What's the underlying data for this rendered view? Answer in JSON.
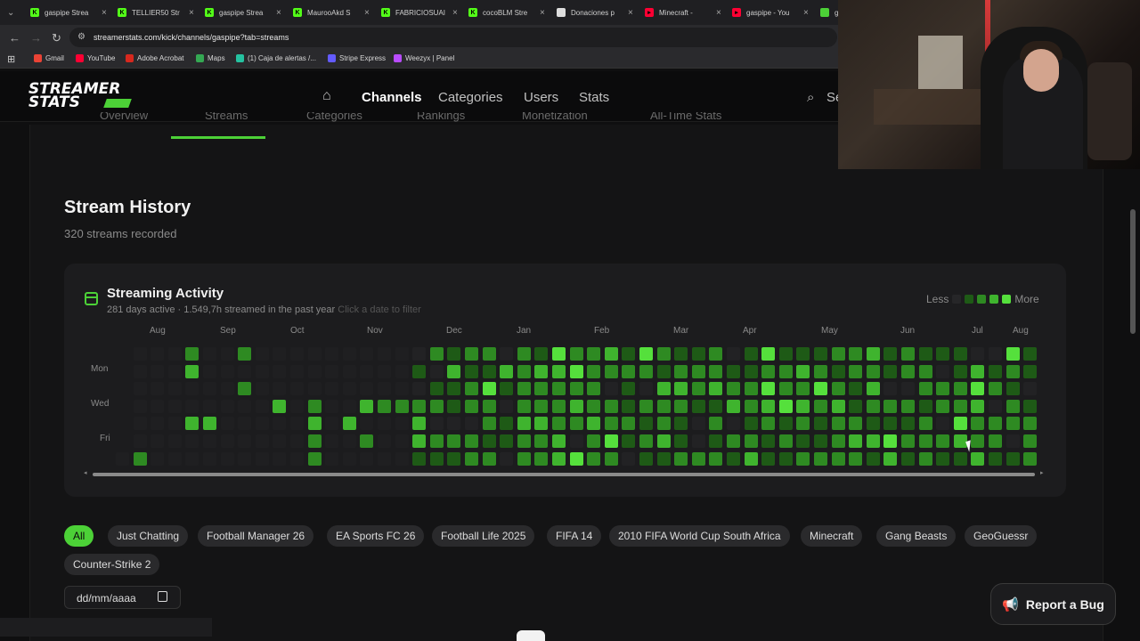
{
  "browser": {
    "tabs": [
      {
        "title": "gaspipe Strea",
        "icon": "kick-icon",
        "color": "#53fc18"
      },
      {
        "title": "TELLIER50 Str",
        "icon": "kick-icon",
        "color": "#53fc18"
      },
      {
        "title": "gaspipe Strea",
        "icon": "kick-icon",
        "color": "#53fc18"
      },
      {
        "title": "MaurooAkd S",
        "icon": "kick-icon",
        "color": "#53fc18"
      },
      {
        "title": "FABRICIOSUAI",
        "icon": "kick-icon",
        "color": "#53fc18"
      },
      {
        "title": "cocoBLM Stre",
        "icon": "kick-icon",
        "color": "#53fc18"
      },
      {
        "title": "Donaciones p",
        "icon": "globe-icon",
        "color": "#dddddd"
      },
      {
        "title": "Minecraft - ",
        "icon": "youtube-icon",
        "color": "#ff0033"
      },
      {
        "title": "gaspipe - You",
        "icon": "youtube-icon",
        "color": "#ff0033"
      },
      {
        "title": "ga",
        "icon": "streamerstats-icon",
        "color": "#4cd137"
      }
    ],
    "url": "streamerstats.com/kick/channels/gaspipe?tab=streams",
    "bookmarks": [
      {
        "label": "Gmail",
        "color": "#ea4335"
      },
      {
        "label": "YouTube",
        "color": "#ff0033"
      },
      {
        "label": "Adobe Acrobat",
        "color": "#d7281e"
      },
      {
        "label": "Maps",
        "color": "#34a853"
      },
      {
        "label": "(1) Caja de alertas /...",
        "color": "#25c2a0"
      },
      {
        "label": "Stripe Express",
        "color": "#635bff"
      },
      {
        "label": "Weezyx | Panel",
        "color": "#b94cff"
      }
    ]
  },
  "site": {
    "logo_line1": "STREAMER",
    "logo_line2": "STATS",
    "nav": {
      "channels": "Channels",
      "categories": "Categories",
      "users": "Users",
      "stats": "Stats",
      "search": "Se"
    },
    "subtabs": [
      "Overview",
      "Streams",
      "Categories",
      "Rankings",
      "Monetization",
      "All-Time Stats"
    ],
    "accent": "#4cd137"
  },
  "page": {
    "title": "Stream History",
    "subtitle": "320 streams recorded"
  },
  "activity": {
    "title": "Streaming Activity",
    "summary": "281 days active · 1.549,7h streamed in the past year",
    "hint": "Click a date to filter",
    "legend_less": "Less",
    "legend_more": "More",
    "legend_colors": [
      "#262628",
      "#1e5a16",
      "#2e8a22",
      "#3fb42e",
      "#55e03c"
    ],
    "months": [
      "Aug",
      "Sep",
      "Oct",
      "Nov",
      "Dec",
      "Jan",
      "Feb",
      "Mar",
      "Apr",
      "May",
      "Jun",
      "Jul",
      "Aug"
    ],
    "day_labels": [
      "Mon",
      "Wed",
      "Fri"
    ]
  },
  "filters": {
    "chips": [
      "All",
      "Just Chatting",
      "Football Manager 26",
      "EA Sports FC 26",
      "Football Life 2025",
      "FIFA 14",
      "2010 FIFA World Cup South Africa",
      "Minecraft",
      "Gang Beasts",
      "GeoGuessr",
      "Counter-Strike 2"
    ],
    "date_placeholder": "dd/mm/aaaa"
  },
  "report_bug": "Report a Bug"
}
